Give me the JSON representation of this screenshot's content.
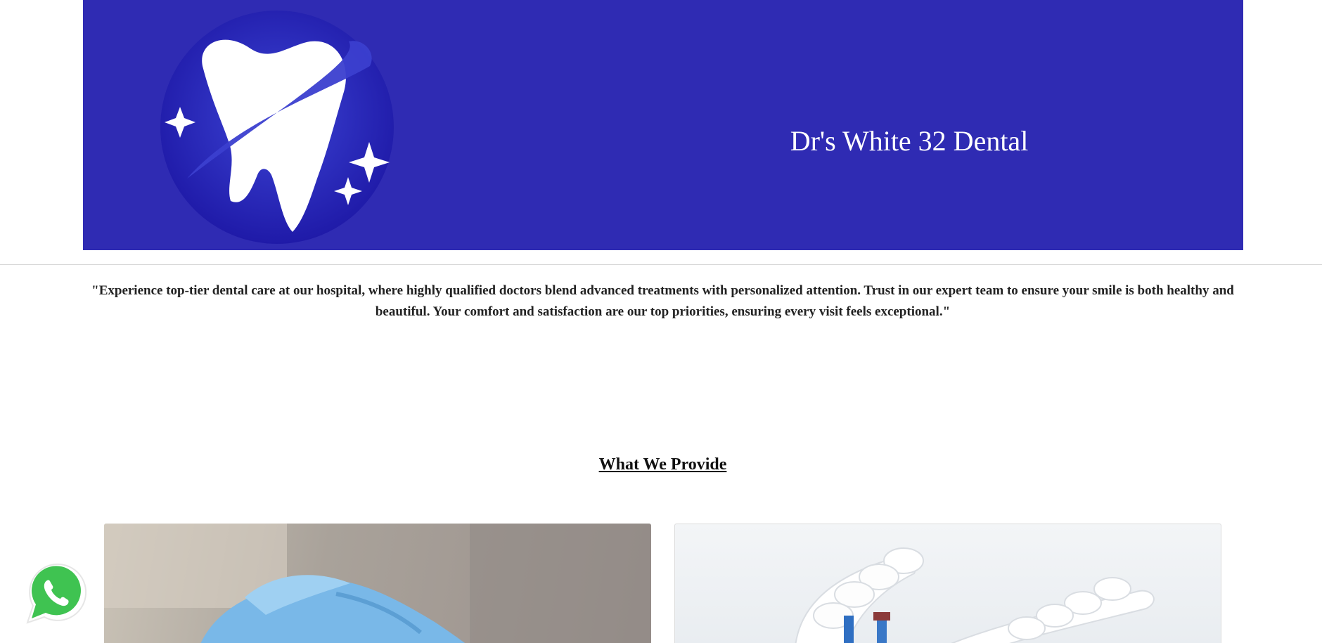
{
  "site": {
    "title": "Dr's White 32 Dental",
    "brand_color": "#2f2bb3"
  },
  "tagline": "\"Experience top-tier dental care at our hospital, where highly qualified doctors blend advanced treatments with personalized attention. Trust in our expert team to ensure your smile is both healthy and beautiful. Your comfort and satisfaction are our top priorities, ensuring every visit feels exceptional.\"",
  "services": {
    "heading": "What We Provide",
    "cards": [
      {
        "image": "gloved-hand-dental-photo"
      },
      {
        "image": "dental-implant-bridge-photo"
      }
    ]
  },
  "floating": {
    "icon": "whatsapp-icon",
    "color": "#3fc351"
  }
}
